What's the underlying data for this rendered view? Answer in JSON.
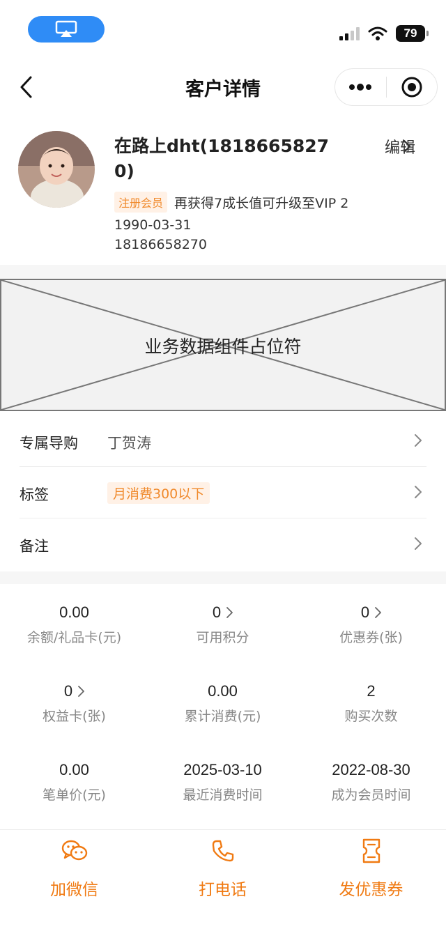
{
  "status_bar": {
    "battery": "79"
  },
  "nav": {
    "title": "客户详情"
  },
  "profile": {
    "name": "在路上dht(18186658270)",
    "edit_label": "编辑",
    "member_badge": "注册会员",
    "upgrade_text": "再获得7成长值可升级至VIP 2",
    "birthday": "1990-03-31",
    "phone": "18186658270"
  },
  "placeholder": {
    "text": "业务数据组件占位符"
  },
  "list": {
    "guide_label": "专属导购",
    "guide_value": "丁贺涛",
    "tag_label": "标签",
    "tag_value": "月消费300以下",
    "note_label": "备注"
  },
  "stats": [
    {
      "value": "0.00",
      "label": "余额/礼品卡(元)"
    },
    {
      "value": "0",
      "label": "可用积分"
    },
    {
      "value": "0",
      "label": "优惠券(张)"
    },
    {
      "value": "0",
      "label": "权益卡(张)"
    },
    {
      "value": "0.00",
      "label": "累计消费(元)"
    },
    {
      "value": "2",
      "label": "购买次数"
    },
    {
      "value": "0.00",
      "label": "笔单价(元)"
    },
    {
      "value": "2025-03-10",
      "label": "最近消费时间"
    },
    {
      "value": "2022-08-30",
      "label": "成为会员时间"
    }
  ],
  "actions": {
    "wechat": "加微信",
    "call": "打电话",
    "coupon": "发优惠券"
  },
  "colors": {
    "accent": "#f07a12",
    "badge_bg": "#fff1e6",
    "airplay": "#2f8cf6"
  }
}
